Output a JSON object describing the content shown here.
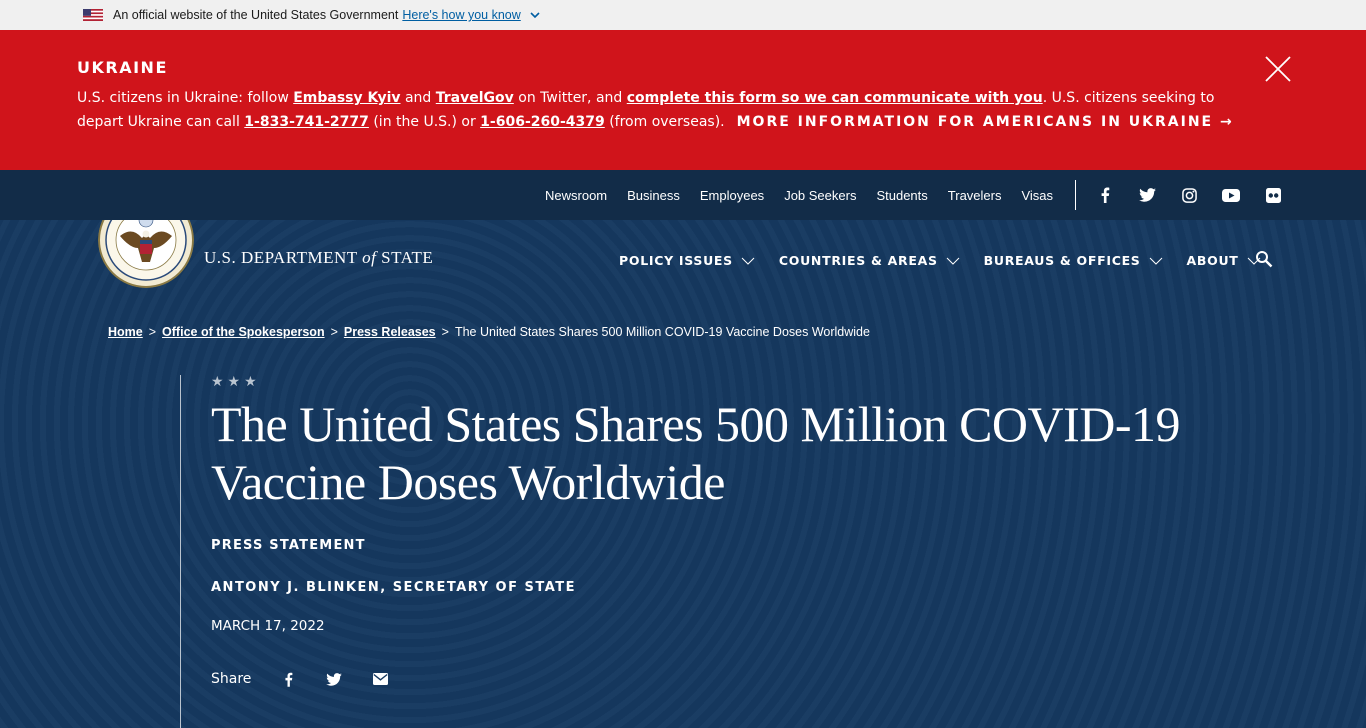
{
  "gov_banner": {
    "text": "An official website of the United States Government",
    "link": "Here's how you know"
  },
  "alert": {
    "title": "UKRAINE",
    "t1": "U.S. citizens in Ukraine: follow ",
    "l1": "Embassy Kyiv",
    "t2": " and ",
    "l2": "TravelGov",
    "t3": " on Twitter, and ",
    "l3": "complete this form so we can communicate with you",
    "t4": ". U.S. citizens seeking to depart Ukraine can call ",
    "l4": "1-833-741-2777",
    "t5": " (in the U.S.) or ",
    "l5": "1-606-260-4379",
    "t6": " (from overseas).",
    "more": "MORE INFORMATION FOR AMERICANS IN UKRAINE →"
  },
  "utility": {
    "links": [
      "Newsroom",
      "Business",
      "Employees",
      "Job Seekers",
      "Students",
      "Travelers",
      "Visas"
    ]
  },
  "header": {
    "logo_pre": "U.S. DEPARTMENT ",
    "logo_of": "of",
    "logo_post": " STATE",
    "nav": [
      "POLICY ISSUES",
      "COUNTRIES & AREAS",
      "BUREAUS & OFFICES",
      "ABOUT"
    ]
  },
  "breadcrumb": {
    "home": "Home",
    "spokesperson": "Office of the Spokesperson",
    "press": "Press Releases",
    "current": "The United States Shares 500 Million COVID-19 Vaccine Doses Worldwide",
    "sep": ">"
  },
  "article": {
    "stars": "★★★",
    "title": "The United States Shares 500 Million COVID-19 Vaccine Doses Worldwide",
    "type": "PRESS STATEMENT",
    "author": "ANTONY J. BLINKEN, SECRETARY OF STATE",
    "date": "MARCH 17, 2022",
    "share_label": "Share"
  },
  "colors": {
    "alert_red": "#d0141b",
    "navy": "#15385f",
    "link_blue": "#005ea2"
  }
}
